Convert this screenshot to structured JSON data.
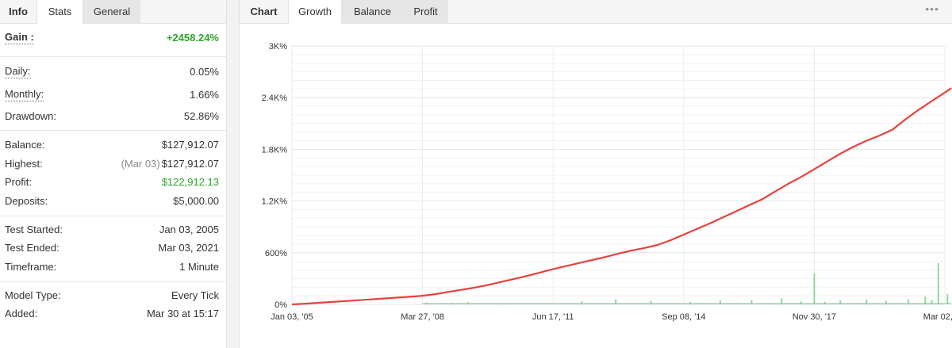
{
  "stats_panel": {
    "tabs": [
      {
        "label": "Info"
      },
      {
        "label": "Stats"
      },
      {
        "label": "General"
      }
    ],
    "active_tab": "Stats",
    "rows": {
      "gain": {
        "label": "Gain :",
        "value": "+2458.24%"
      },
      "daily": {
        "label": "Daily:",
        "value": "0.05%"
      },
      "monthly": {
        "label": "Monthly:",
        "value": "1.66%"
      },
      "drawdown": {
        "label": "Drawdown:",
        "value": "52.86%"
      },
      "balance": {
        "label": "Balance:",
        "value": "$127,912.07"
      },
      "highest": {
        "label": "Highest:",
        "note": "(Mar 03)",
        "value": "$127,912.07"
      },
      "profit": {
        "label": "Profit:",
        "value": "$122,912.13"
      },
      "deposits": {
        "label": "Deposits:",
        "value": "$5,000.00"
      },
      "test_started": {
        "label": "Test Started:",
        "value": "Jan 03, 2005"
      },
      "test_ended": {
        "label": "Test Ended:",
        "value": "Mar 03, 2021"
      },
      "timeframe": {
        "label": "Timeframe:",
        "value": "1 Minute"
      },
      "model_type": {
        "label": "Model Type:",
        "value": "Every Tick"
      },
      "added": {
        "label": "Added:",
        "value": "Mar 30 at 15:17"
      }
    },
    "colors": {
      "positive": "#2aa52a"
    }
  },
  "chart_panel": {
    "tabs": [
      {
        "label": "Chart"
      },
      {
        "label": "Growth"
      },
      {
        "label": "Balance"
      },
      {
        "label": "Profit"
      }
    ],
    "active_tab": "Growth",
    "more_icon": "•••"
  },
  "chart_data": {
    "type": "line",
    "title": "",
    "xlabel": "",
    "ylabel": "",
    "y_ticks": [
      "0%",
      "600%",
      "1.2K%",
      "1.8K%",
      "2.4K%",
      "3K%"
    ],
    "ylim": [
      0,
      3000
    ],
    "x_ticks": [
      "Jan 03, '05",
      "Mar 27, '08",
      "Jun 17, '11",
      "Sep 08, '14",
      "Nov 30, '17",
      "Mar 02, '21"
    ],
    "x_tick_index": [
      0,
      1,
      2,
      3,
      4,
      5
    ],
    "grid": true,
    "series": [
      {
        "color": "#e8413c",
        "x": [
          0,
          0.1,
          0.2,
          0.3,
          0.4,
          0.5,
          0.6,
          0.7,
          0.8,
          0.9,
          1.0,
          1.1,
          1.2,
          1.3,
          1.4,
          1.5,
          1.6,
          1.7,
          1.8,
          1.9,
          2.0,
          2.1,
          2.2,
          2.3,
          2.4,
          2.5,
          2.6,
          2.7,
          2.8,
          2.9,
          3.0,
          3.1,
          3.2,
          3.3,
          3.4,
          3.5,
          3.6,
          3.7,
          3.8,
          3.9,
          4.0,
          4.1,
          4.2,
          4.3,
          4.4,
          4.5,
          4.6,
          4.7,
          4.8,
          4.9,
          5.0,
          5.05
        ],
        "y": [
          0,
          8,
          18,
          28,
          38,
          48,
          58,
          68,
          78,
          88,
          100,
          120,
          145,
          170,
          195,
          225,
          260,
          295,
          330,
          370,
          410,
          445,
          480,
          515,
          550,
          590,
          625,
          655,
          690,
          745,
          810,
          875,
          940,
          1010,
          1080,
          1150,
          1220,
          1310,
          1400,
          1480,
          1570,
          1660,
          1750,
          1830,
          1900,
          1960,
          2030,
          2150,
          2260,
          2360,
          2460,
          2510
        ]
      }
    ],
    "volume_bars": {
      "color": "#7fcf8f",
      "x": [
        1.03,
        1.22,
        1.35,
        1.6,
        2.22,
        2.48,
        2.75,
        3.05,
        3.28,
        3.52,
        3.75,
        3.9,
        4.0,
        4.08,
        4.2,
        4.4,
        4.55,
        4.72,
        4.85,
        4.9,
        4.95,
        5.02
      ],
      "y": [
        20,
        18,
        25,
        15,
        35,
        60,
        40,
        30,
        45,
        50,
        70,
        35,
        360,
        30,
        45,
        55,
        40,
        60,
        90,
        50,
        480,
        120
      ]
    }
  }
}
